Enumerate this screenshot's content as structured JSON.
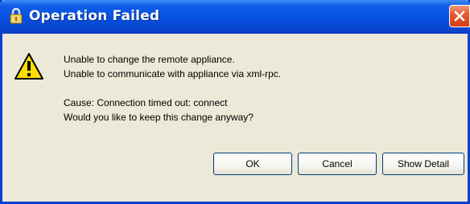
{
  "dialog": {
    "title": "Operation Failed",
    "messages": {
      "line1": "Unable to change the remote appliance.",
      "line2": "Unable to communicate with appliance via xml-rpc.",
      "line3": "Cause: Connection timed out: connect",
      "line4": "Would you like to keep this change anyway?"
    },
    "buttons": {
      "ok": "OK",
      "cancel": "Cancel",
      "show_detail": "Show Detail"
    },
    "icons": {
      "title": "lock-icon",
      "message": "warning-icon",
      "close": "close-icon"
    }
  },
  "colors": {
    "titlebar": "#0650e0",
    "dialog_background": "#ece9d8",
    "close_button": "#e45b32",
    "warning_fill": "#ffdd00"
  }
}
